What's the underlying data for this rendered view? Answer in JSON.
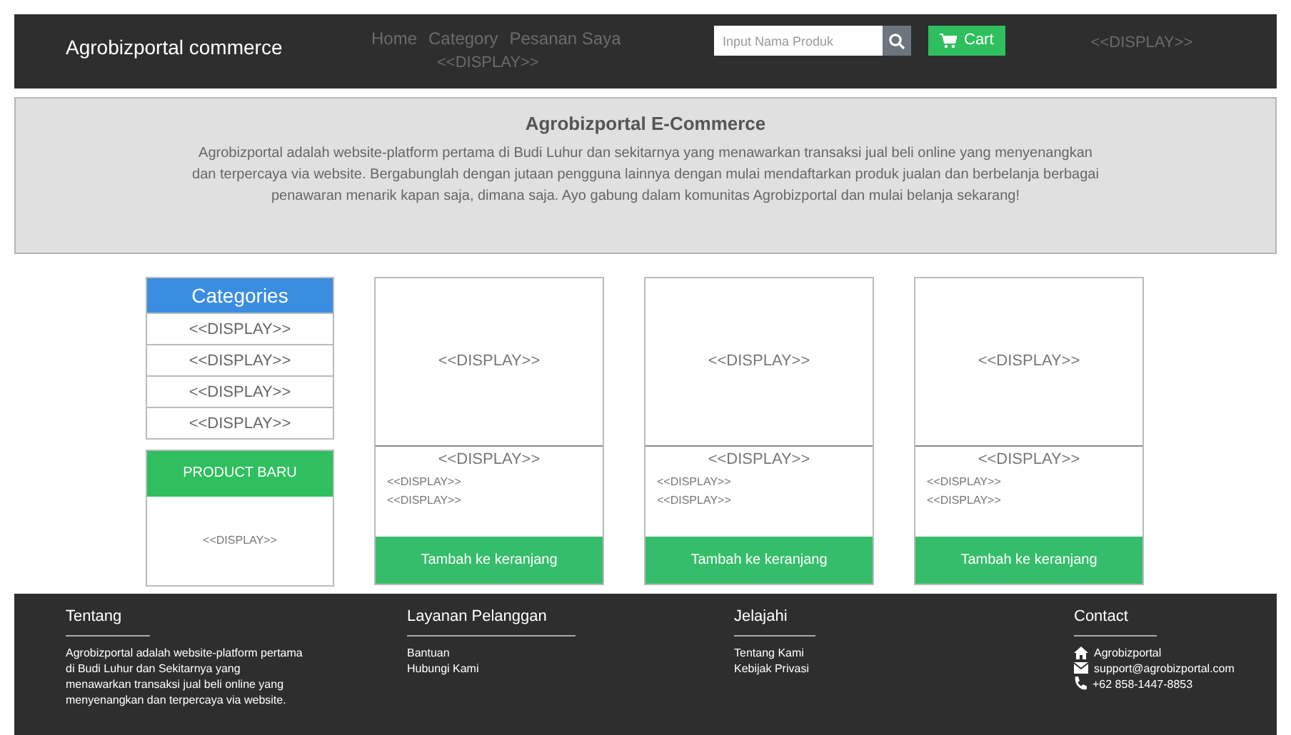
{
  "navbar": {
    "brand": "Agrobizportal commerce",
    "links": [
      {
        "label": "Home"
      },
      {
        "label": "Category"
      },
      {
        "label": "Pesanan Saya"
      }
    ],
    "links_extra": "<<DISPLAY>>",
    "search": {
      "placeholder": "Input Nama Produk"
    },
    "cart": "Cart",
    "user": "<<DISPLAY>>"
  },
  "banner": {
    "title": "Agrobizportal E-Commerce",
    "text": "Agrobizportal adalah website-platform pertama di Budi Luhur dan sekitarnya yang menawarkan transaksi jual beli online yang menyenangkan dan terpercaya via website. Bergabunglah dengan jutaan pengguna lainnya dengan mulai mendaftarkan produk jualan dan berbelanja berbagai penawaran menarik kapan saja, dimana saja. Ayo gabung dalam komunitas Agrobizportal dan mulai belanja sekarang!"
  },
  "sidebar": {
    "title": "Categories",
    "items": [
      "<<DISPLAY>>",
      "<<DISPLAY>>",
      "<<DISPLAY>>",
      "<<DISPLAY>>"
    ],
    "new_product": {
      "title": "PRODUCT BARU",
      "content": "<<DISPLAY>>"
    }
  },
  "products": [
    {
      "image": "<<DISPLAY>>",
      "name": "<<DISPLAY>>",
      "details": [
        "<<DISPLAY>>",
        "<<DISPLAY>>"
      ],
      "button": "Tambah ke keranjang"
    },
    {
      "image": "<<DISPLAY>>",
      "name": "<<DISPLAY>>",
      "details": [
        "<<DISPLAY>>",
        "<<DISPLAY>>"
      ],
      "button": "Tambah ke keranjang"
    },
    {
      "image": "<<DISPLAY>>",
      "name": "<<DISPLAY>>",
      "details": [
        "<<DISPLAY>>",
        "<<DISPLAY>>"
      ],
      "button": "Tambah ke keranjang"
    }
  ],
  "footer": {
    "columns": [
      {
        "kind": "text",
        "title": "Tentang",
        "text": "Agrobizportal adalah website-platform pertama di Budi Luhur dan Sekitarnya yang menawarkan transaksi jual beli online yang menyenangkan dan terpercaya via website."
      },
      {
        "kind": "links",
        "title": "Layanan Pelanggan",
        "links": [
          "Bantuan",
          "Hubungi Kami"
        ]
      },
      {
        "kind": "links",
        "title": "Jelajahi",
        "links": [
          "Tentang Kami",
          "Kebijak Privasi"
        ]
      },
      {
        "kind": "contact",
        "title": "Contact",
        "items": [
          {
            "kind": "home",
            "text": "Agrobizportal"
          },
          {
            "kind": "email",
            "text": "support@agrobizportal.com"
          },
          {
            "kind": "phone",
            "text": "+62 858-1447-8853"
          }
        ]
      }
    ]
  }
}
